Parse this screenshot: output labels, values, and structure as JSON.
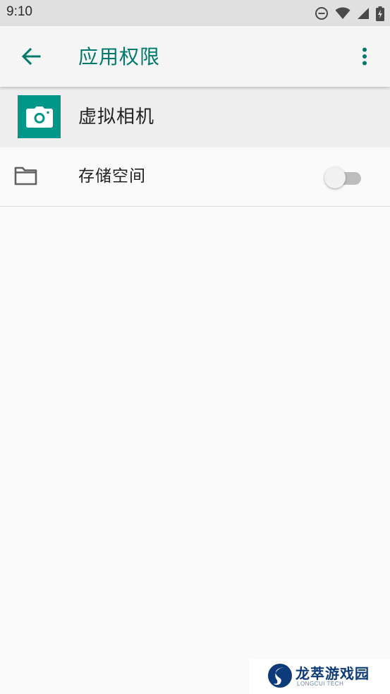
{
  "status_bar": {
    "time": "9:10",
    "icons": [
      "do-not-disturb-icon",
      "wifi-icon",
      "cellular-signal-icon",
      "battery-charging-icon"
    ]
  },
  "app_bar": {
    "title": "应用权限",
    "back_icon": "arrow-back-icon",
    "more_icon": "more-vert-icon",
    "accent_color": "#00796b"
  },
  "app_header": {
    "name": "虚拟相机",
    "icon": "camera-icon",
    "icon_bg_color": "#009688"
  },
  "permissions": [
    {
      "label": "存储空间",
      "icon": "folder-icon",
      "enabled": false
    }
  ],
  "watermark": {
    "name": "龙萃游戏园",
    "sub": "LONGCUI TECH"
  }
}
